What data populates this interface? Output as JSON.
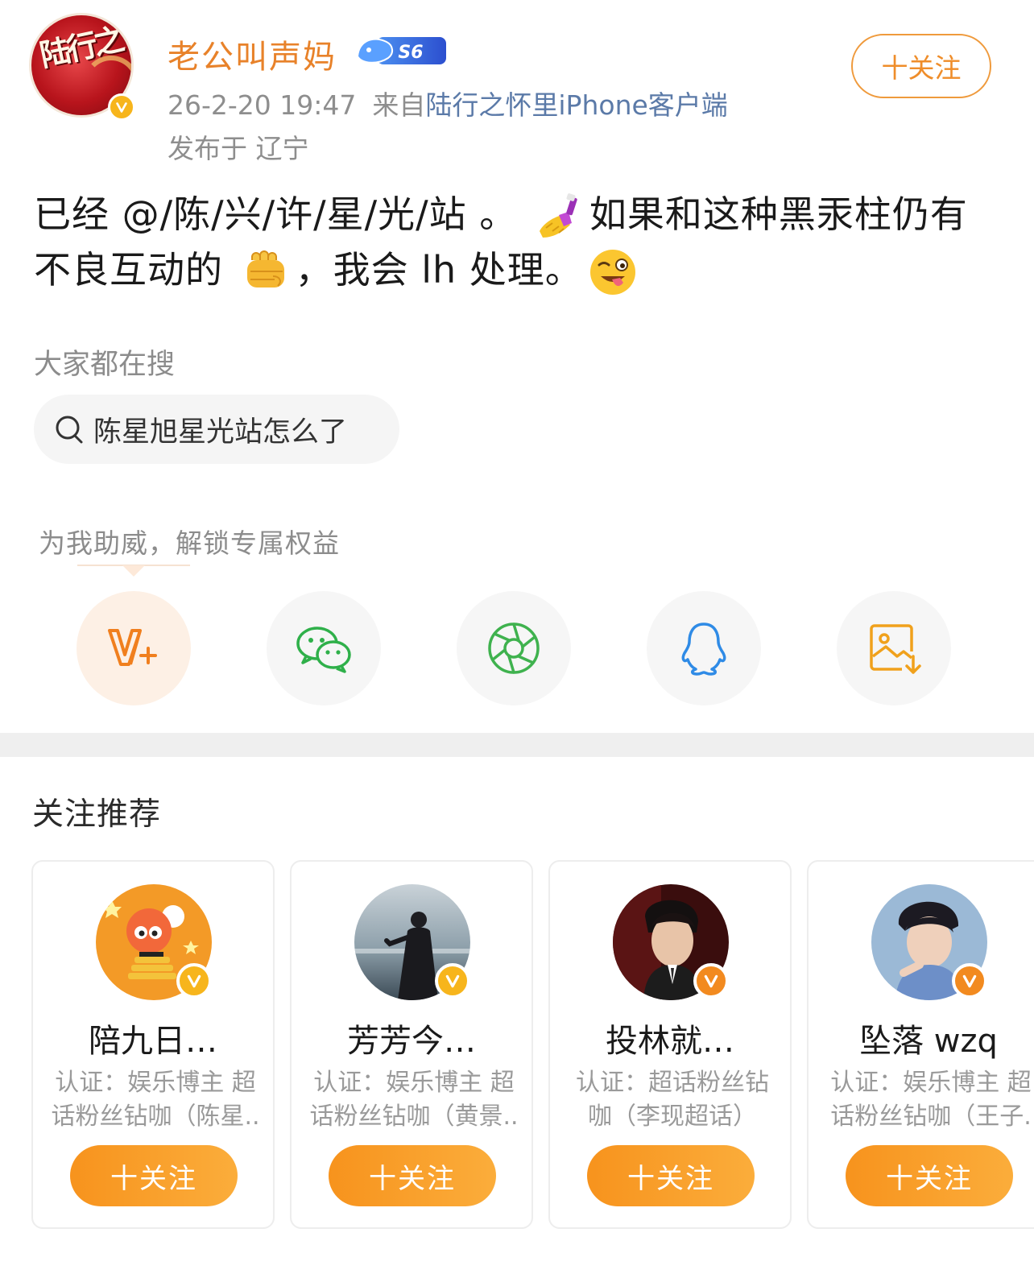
{
  "post": {
    "user_name": "老公叫声妈",
    "level_badge": "S6",
    "time": "26-2-20 19:47",
    "source_prefix": "来自",
    "source": "陆行之怀里iPhone客户端",
    "location": "发布于 辽宁",
    "follow_label": "十关注",
    "body_part1": "已经 @/陈/兴/许/星/光/站 。",
    "body_part2": "如果和这种黑汞柱仍有不良互动的 ",
    "body_part3": "，我会 lh 处理。",
    "avatar_text": "陆行之",
    "emojis": [
      "nail-polish-emoji",
      "fist-emoji",
      "winking-tongue-emoji"
    ]
  },
  "hot_search": {
    "title": "大家都在搜",
    "query": "陈星旭星光站怎么了"
  },
  "share": {
    "tip": "为我助威，解锁专属权益",
    "buttons": [
      "v-plus-icon",
      "wechat-icon",
      "moments-icon",
      "qq-icon",
      "save-image-icon"
    ]
  },
  "recommend": {
    "title": "关注推荐",
    "follow_label": "十关注",
    "cards": [
      {
        "name": "陪九日…",
        "desc": "认证：娱乐博主 超话粉丝钻咖（陈星..",
        "badge": "gold"
      },
      {
        "name": "芳芳今…",
        "desc": "认证：娱乐博主 超话粉丝钻咖（黄景..",
        "badge": "gold"
      },
      {
        "name": "投林就…",
        "desc": "认证：超话粉丝钻咖（李现超话）",
        "badge": "orange"
      },
      {
        "name": "坠落 wzq",
        "desc": "认证：娱乐博主 超话粉丝钻咖（王子.",
        "badge": "orange"
      }
    ]
  },
  "colors": {
    "accent": "#f7931d",
    "name": "#e8822a",
    "source_link": "#5b7aa8",
    "verify_gold": "#f7b51c",
    "verify_orange": "#f28a1f"
  }
}
